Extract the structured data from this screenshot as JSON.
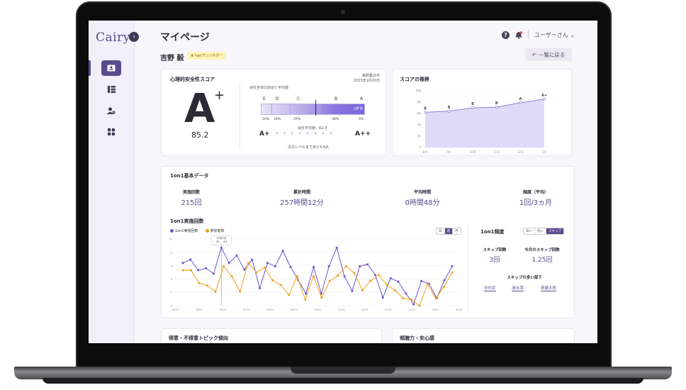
{
  "app": {
    "logo": "Cairy"
  },
  "header": {
    "title": "マイページ",
    "user_menu": "ユーザーさん ⌄"
  },
  "profile": {
    "name": "吉野 毅",
    "badge": "♛ hariアンバサダー",
    "back_button": "一覧に戻る"
  },
  "score_card": {
    "title": "心理的安全性スコア",
    "last_measured_label": "最終集計日",
    "last_measured_date": "2023年1月20日",
    "grade": "A",
    "grade_modifier": "+",
    "score": "85.2",
    "distribution_title": "会社全体の割合と平均値",
    "levels": [
      "E",
      "D",
      "C",
      "B",
      "A"
    ],
    "percentages": [
      "10%",
      "18%",
      "29%",
      "38%",
      "5%"
    ],
    "you_label": "吉野 毅",
    "company_average": "会社平均値：62.3",
    "current_level": "A+",
    "next_level": "A++",
    "next_level_note": "次のレベルまであと4.8点",
    "fill_ratio": 1.0
  },
  "trend_card": {
    "title": "スコアの推移",
    "chart_data": {
      "type": "area",
      "x": [
        "8月",
        "9月",
        "10月",
        "11月",
        "12月",
        "1月"
      ],
      "values": [
        62,
        64,
        70,
        71,
        79,
        85.2
      ],
      "point_labels": [
        "B",
        "B",
        "B",
        "B",
        "A",
        "A+"
      ],
      "ylim": [
        0,
        100
      ],
      "yticks": [
        0,
        20,
        40,
        60,
        80,
        100
      ],
      "grid": true,
      "colors": {
        "line": "#8e7de3",
        "fill": "#dcd6f7"
      }
    }
  },
  "basic_data": {
    "title": "1on1基本データ",
    "stats": [
      {
        "label": "実施回数",
        "value": "215回"
      },
      {
        "label": "累計時間",
        "value": "257時間12分"
      },
      {
        "label": "平均時間",
        "value": "0時間48分"
      },
      {
        "label": "頻度（平均）",
        "value": "1回/3ヵ月"
      }
    ]
  },
  "count_chart": {
    "title": "1on1実施回数",
    "period_tabs": [
      "日",
      "週",
      "月"
    ],
    "active_tab": "週",
    "tooltip": {
      "date": "12月1日",
      "line1": "40",
      "line2": "8人"
    },
    "chart_data": {
      "type": "line",
      "x": [
        "05/01",
        "05/08",
        "05/15",
        "05/22",
        "05/29",
        "06/05",
        "06/12",
        "06/19",
        "06/26",
        "07/03",
        "07/10",
        "07/17",
        "07/24",
        "07/31",
        "08/07",
        "08/14",
        "08/21",
        "08/28",
        "09/04",
        "09/11",
        "09/18",
        "09/25",
        "10/02",
        "10/09",
        "10/16",
        "10/23",
        "10/30",
        "11/06",
        "11/13",
        "11/20",
        "11/27",
        "12/01",
        "12/08",
        "12/15",
        "12/22",
        "12/29",
        "01/05",
        "01/12",
        "01/19",
        "01/26",
        "01/31"
      ],
      "xticks": [
        "05/01",
        "06/01",
        "06/31",
        "07/31",
        "08/31",
        "09/31",
        "10/31",
        "11/31",
        "12/31",
        "01/31",
        "02/31",
        "03/31",
        "04/31"
      ],
      "ylim": [
        0,
        10
      ],
      "yticks": [
        0,
        2,
        4,
        6,
        8,
        10
      ],
      "grid": true,
      "series": [
        {
          "name": "1on1実施回数",
          "color": "#6b55c9",
          "values": [
            6.4,
            6.9,
            5.3,
            5.6,
            4.8,
            8.7,
            6.4,
            7.5,
            5.4,
            6.9,
            2.6,
            6.4,
            5.9,
            8.2,
            5.8,
            3.8,
            1.8,
            5.8,
            1.8,
            5.9,
            8.7,
            4.4,
            2.2,
            5.9,
            6.2,
            4.6,
            1.2,
            4.1,
            3.6,
            1.8,
            0.2,
            3.7,
            3.3,
            1.1,
            3.8,
            5.9
          ]
        },
        {
          "name": "参加者数",
          "color": "#f0a017",
          "values": [
            5.3,
            5.3,
            3.4,
            3.0,
            2.1,
            5.9,
            4.4,
            2.1,
            6.4,
            5.0,
            5.7,
            3.8,
            3.1,
            1.6,
            4.4,
            0.9,
            4.4,
            1.2,
            3.7,
            4.5,
            5.9,
            4.9,
            2.3,
            3.7,
            4.6,
            3.1,
            2.3,
            1.1,
            0.9,
            0.0,
            3.2,
            1.1,
            2.8,
            5.0
          ]
        }
      ]
    }
  },
  "frequency": {
    "title": "1on1頻度",
    "tabs": [
      "高い",
      "低い",
      "スキップ"
    ],
    "active_tab": "スキップ",
    "skip_count_label": "スキップ回数",
    "skip_count_value": "3回",
    "monthly_skip_label": "今月のスキップ回数",
    "monthly_skip_value": "1.25回",
    "most_skipped_label": "スキップの多い部下",
    "members": [
      "中村花",
      "清水澪",
      "斎藤太郎"
    ]
  },
  "bottom_cards": {
    "left_title": "得意・不得意トピック傾向",
    "right_title": "傾聴力・安心感"
  }
}
